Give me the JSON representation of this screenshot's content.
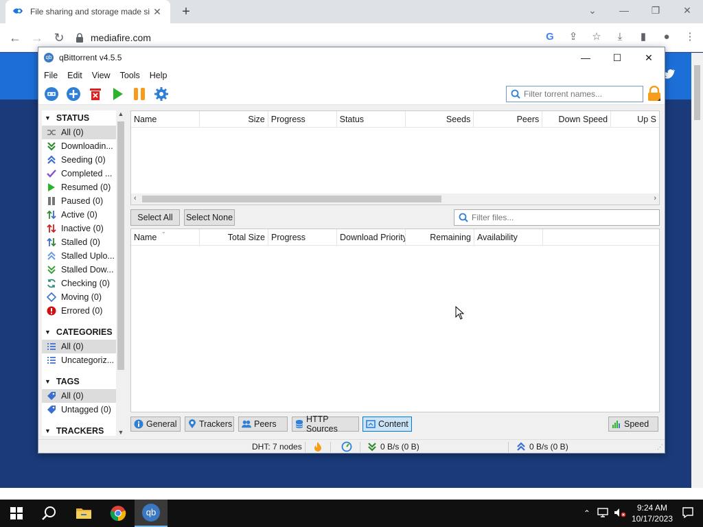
{
  "browser": {
    "tab_title": "File sharing and storage made si",
    "tab_close": "✕",
    "new_tab": "+",
    "url": "mediafire.com"
  },
  "qbt": {
    "title": "qBittorrent v4.5.5",
    "menu": [
      "File",
      "Edit",
      "View",
      "Tools",
      "Help"
    ],
    "search_placeholder": "Filter torrent names...",
    "sidebar": {
      "status_header": "STATUS",
      "status_items": [
        {
          "label": "All (0)",
          "icon": "shuffle-icon",
          "selected": true
        },
        {
          "label": "Downloadin...",
          "icon": "download-arrow-icon"
        },
        {
          "label": "Seeding (0)",
          "icon": "upload-arrow-icon"
        },
        {
          "label": "Completed ...",
          "icon": "check-icon"
        },
        {
          "label": "Resumed (0)",
          "icon": "play-icon"
        },
        {
          "label": "Paused (0)",
          "icon": "pause-icon"
        },
        {
          "label": "Active (0)",
          "icon": "updown-icon"
        },
        {
          "label": "Inactive (0)",
          "icon": "updown-red-icon"
        },
        {
          "label": "Stalled (0)",
          "icon": "updown-icon"
        },
        {
          "label": "Stalled Uplo...",
          "icon": "upload-arrow-icon"
        },
        {
          "label": "Stalled Dow...",
          "icon": "download-arrow-icon"
        },
        {
          "label": "Checking (0)",
          "icon": "refresh-icon"
        },
        {
          "label": "Moving (0)",
          "icon": "diamond-icon"
        },
        {
          "label": "Errored (0)",
          "icon": "error-icon"
        }
      ],
      "categories_header": "CATEGORIES",
      "category_items": [
        {
          "label": "All (0)",
          "selected": true
        },
        {
          "label": "Uncategoriz..."
        }
      ],
      "tags_header": "TAGS",
      "tag_items": [
        {
          "label": "All (0)",
          "selected": true
        },
        {
          "label": "Untagged (0)"
        }
      ],
      "trackers_header": "TRACKERS"
    },
    "torrent_columns": [
      "Name",
      "Size",
      "Progress",
      "Status",
      "Seeds",
      "Peers",
      "Down Speed",
      "Up S"
    ],
    "buttons": {
      "select_all": "Select All",
      "select_none": "Select None"
    },
    "filter_files_placeholder": "Filter files...",
    "file_columns": [
      "Name",
      "Total Size",
      "Progress",
      "Download Priority",
      "Remaining",
      "Availability"
    ],
    "tabs": [
      "General",
      "Trackers",
      "Peers",
      "HTTP Sources",
      "Content"
    ],
    "speed_button": "Speed",
    "status": {
      "dht": "DHT: 7 nodes",
      "down": "0 B/s (0 B)",
      "up": "0 B/s (0 B)"
    }
  },
  "taskbar": {
    "time": "9:24 AM",
    "date": "10/17/2023",
    "qb_label": "qb"
  }
}
